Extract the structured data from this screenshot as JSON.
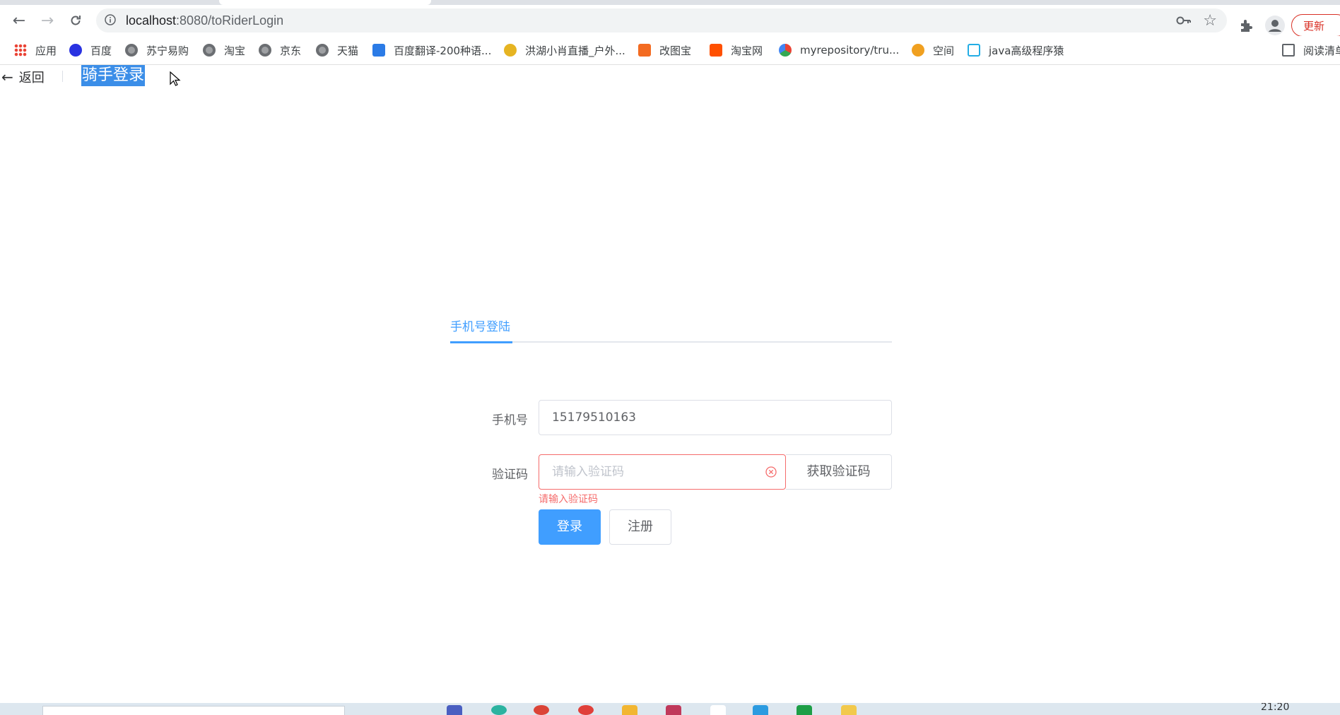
{
  "browser": {
    "url_host": "localhost",
    "url_path": ":8080/toRiderLogin",
    "update_label": "更新",
    "bookmarks": [
      {
        "label": "应用",
        "icon": "apps-grid-icon"
      },
      {
        "label": "百度",
        "icon": "baidu-paw-icon"
      },
      {
        "label": "苏宁易购",
        "icon": "globe-icon"
      },
      {
        "label": "淘宝",
        "icon": "globe-icon"
      },
      {
        "label": "京东",
        "icon": "globe-icon"
      },
      {
        "label": "天猫",
        "icon": "globe-icon"
      },
      {
        "label": "百度翻译-200种语...",
        "icon": "translate-icon"
      },
      {
        "label": "洪湖小肖直播_户外...",
        "icon": "live-icon"
      },
      {
        "label": "改图宝",
        "icon": "image-edit-icon"
      },
      {
        "label": "淘宝网",
        "icon": "taobao-icon"
      },
      {
        "label": "myrepository/tru...",
        "icon": "repository-icon"
      },
      {
        "label": "空间",
        "icon": "qzone-icon"
      },
      {
        "label": "java高级程序猿",
        "icon": "bilibili-icon"
      },
      {
        "label": "阅读清单",
        "icon": "reading-list-icon"
      }
    ]
  },
  "header": {
    "back_label": "返回",
    "title": "骑手登录"
  },
  "tabs": [
    {
      "label": "手机号登陆",
      "active": true
    }
  ],
  "form": {
    "phone_label": "手机号",
    "phone_value": "15179510163",
    "code_label": "验证码",
    "code_placeholder": "请输入验证码",
    "get_code_label": "获取验证码",
    "code_error": "请输入验证码",
    "login_label": "登录",
    "register_label": "注册"
  },
  "taskbar": {
    "clock": "21:20"
  },
  "colors": {
    "primary": "#409eff",
    "danger": "#f56c6c",
    "selection": "#3b8ee8",
    "update": "#d93025"
  }
}
